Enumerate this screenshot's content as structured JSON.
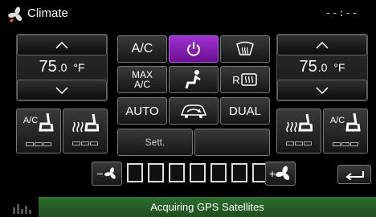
{
  "header": {
    "title": "Climate",
    "clock": "--:--"
  },
  "left_zone": {
    "temp_main": "75",
    "temp_decimal": ".0",
    "unit": "°F"
  },
  "right_zone": {
    "temp_main": "75",
    "temp_decimal": ".0",
    "unit": "°F"
  },
  "center": {
    "ac_label": "A/C",
    "max_ac_line1": "MAX",
    "max_ac_line2": "A/C",
    "auto_label": "AUTO",
    "dual_label": "DUAL",
    "rear_defrost_prefix": "R",
    "settings_label": "Sett."
  },
  "seats": {
    "left_ac_label": "A/C",
    "right_ac_label": "A/C"
  },
  "fan": {
    "level": 0,
    "max_level": 7
  },
  "status": {
    "text": "Acquiring GPS Satellites"
  },
  "colors": {
    "power_active": "#8a1fb8",
    "status_green": "#2a602a"
  }
}
